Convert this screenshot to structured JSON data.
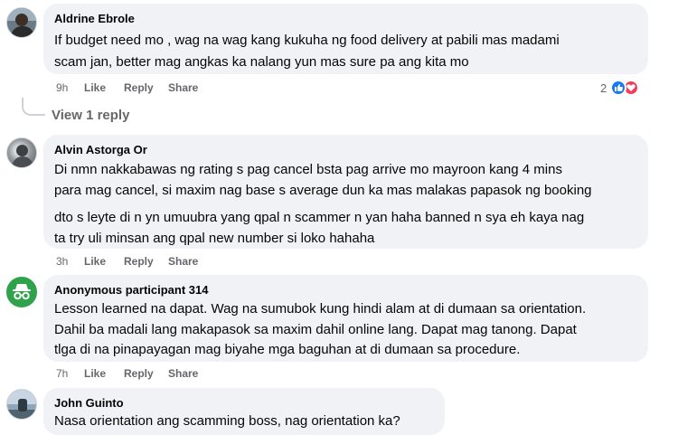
{
  "comments": [
    {
      "author": "Aldrine Ebrole",
      "lines": [
        "If budget need mo , wag na wag kang kukuha ng food delivery at pabili mas madami",
        "scam jan, better mag angkas ka nalang yun mas sure pa ang kita mo"
      ],
      "time": "9h",
      "like": "Like",
      "reply": "Reply",
      "share": "Share",
      "reactions_count": "2",
      "reactions": [
        "like-reaction-icon",
        "love-reaction-icon"
      ],
      "view_replies": "View 1 reply"
    },
    {
      "author": "Alvin Astorga Or",
      "lines": [
        "Di nmn nakkabawas ng rating s pag cancel bsta pag arrive mo mayroon kang 4 mins",
        "para mag cancel, si maxim nag base s average dun ka mas malakas papasok ng booking",
        "dto s leyte di n yn umuubra yang qpal n scammer n yan haha banned n sya eh kaya nag",
        "ta try uli minsan ang qpal new number si loko hahaha"
      ],
      "time": "3h",
      "like": "Like",
      "reply": "Reply",
      "share": "Share"
    },
    {
      "author": "Anonymous participant 314",
      "lines": [
        "Lesson learned na dapat. Wag na sumubok kung hindi alam at di dumaan sa orientation.",
        "Dahil ba madali lang makapasok sa maxim dahil online lang. Dapat mag tanong. Dapat",
        "tlga di na pinapayagan mag biyahe mga baguhan at di dumaan sa procedure."
      ],
      "time": "7h",
      "like": "Like",
      "reply": "Reply",
      "share": "Share",
      "avatar_icon": "anonymous-spy-icon"
    },
    {
      "author": "John Guinto",
      "lines": [
        "Nasa orientation ang scamming boss, nag orientation ka?"
      ]
    }
  ],
  "colors": {
    "bubble": "#f0f2f5",
    "meta_text": "#65676b",
    "anonymous_avatar": "#31a24c",
    "like_blue": "#1877f2",
    "love_red": "#f33e58"
  }
}
